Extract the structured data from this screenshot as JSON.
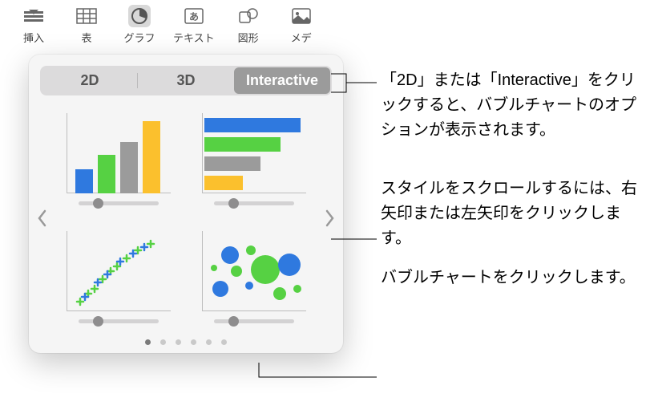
{
  "toolbar": {
    "insert_label": "挿入",
    "table_label": "表",
    "chart_label": "グラフ",
    "text_label": "テキスト",
    "shape_label": "図形",
    "media_label": "メデ"
  },
  "segments": {
    "seg_2d": "2D",
    "seg_3d": "3D",
    "seg_interactive": "Interactive"
  },
  "callouts": {
    "top": "「2D」または「Interactive」をクリックすると、バブルチャートのオプションが表示されます。",
    "middle": "スタイルをスクロールするには、右矢印または左矢印をクリックします。",
    "bottom": "バブルチャートをクリックします。"
  },
  "pager": {
    "count": 6,
    "active_index": 0
  }
}
